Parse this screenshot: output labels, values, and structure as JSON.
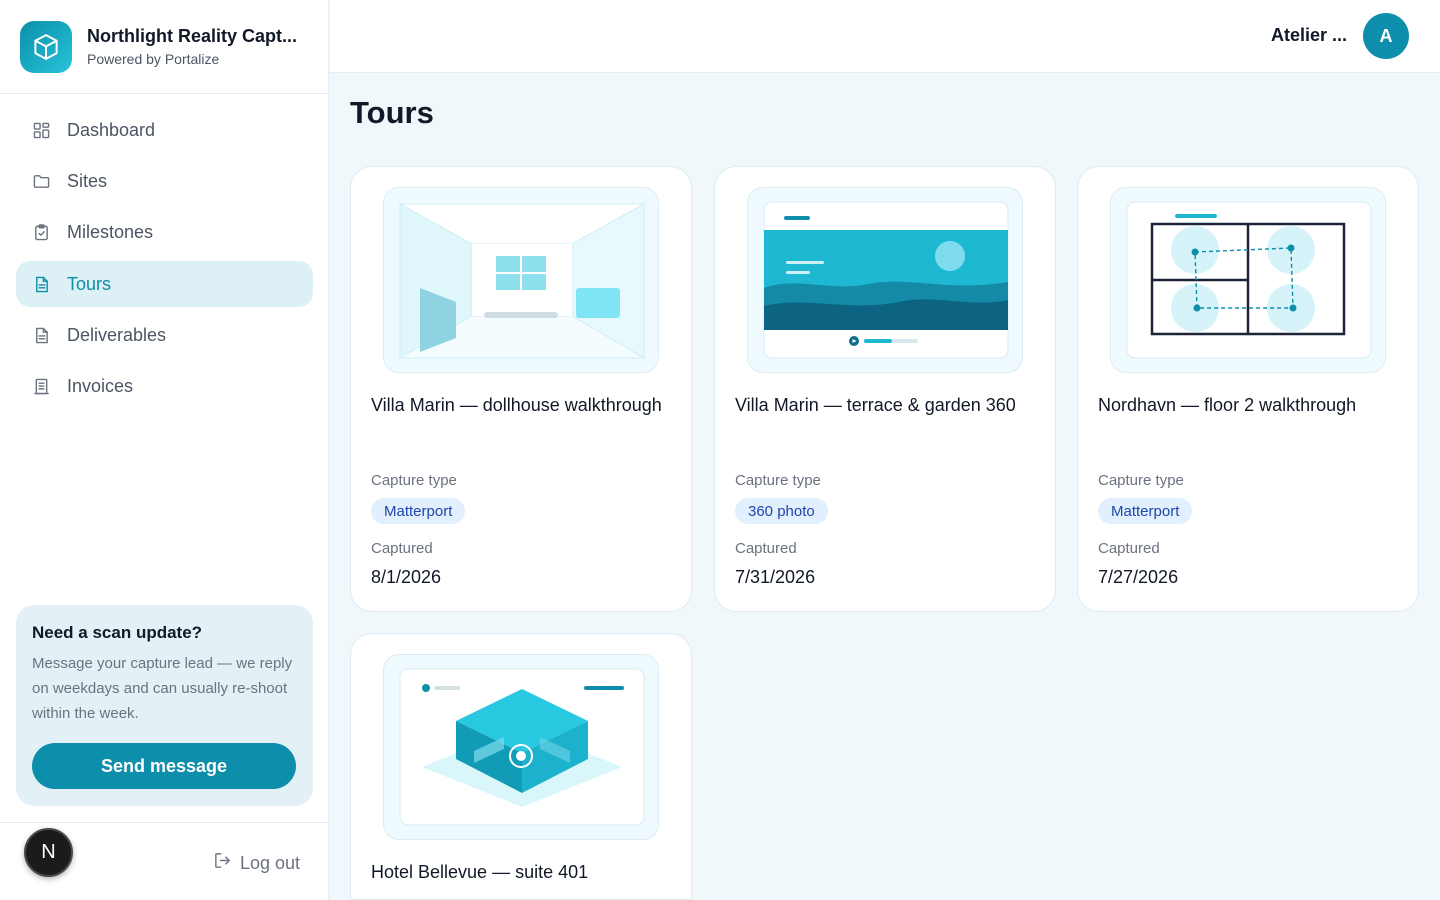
{
  "brand": {
    "name": "Northlight Reality Capt...",
    "subtitle": "Powered by Portalize"
  },
  "nav": {
    "items": [
      {
        "label": "Dashboard",
        "icon": "grid-icon"
      },
      {
        "label": "Sites",
        "icon": "folder-icon"
      },
      {
        "label": "Milestones",
        "icon": "clipboard-check-icon"
      },
      {
        "label": "Tours",
        "icon": "document-icon",
        "active": true
      },
      {
        "label": "Deliverables",
        "icon": "document-icon"
      },
      {
        "label": "Invoices",
        "icon": "receipt-icon"
      }
    ]
  },
  "promo": {
    "title": "Need a scan update?",
    "body": "Message your capture lead — we reply on weekdays and can usually re-shoot within the week.",
    "button": "Send message"
  },
  "footer": {
    "avatar_letter": "N",
    "logout": "Log out"
  },
  "header": {
    "account_name": "Atelier ...",
    "avatar_letter": "A"
  },
  "page": {
    "title": "Tours"
  },
  "tours": [
    {
      "title": "Villa Marin — dollhouse walkthrough",
      "capture_type_label": "Capture type",
      "capture_type": "Matterport",
      "captured_label": "Captured",
      "captured": "8/1/2026"
    },
    {
      "title": "Villa Marin — terrace & garden 360",
      "capture_type_label": "Capture type",
      "capture_type": "360 photo",
      "captured_label": "Captured",
      "captured": "7/31/2026"
    },
    {
      "title": "Nordhavn — floor 2 walkthrough",
      "capture_type_label": "Capture type",
      "capture_type": "Matterport",
      "captured_label": "Captured",
      "captured": "7/27/2026"
    },
    {
      "title": "Hotel Bellevue — suite 401"
    }
  ],
  "colors": {
    "accent": "#0d8fab",
    "active_nav_bg": "#ddf0f6",
    "badge_bg": "#e2efff",
    "badge_text": "#1f47a8",
    "page_bg": "#f0f8fb"
  }
}
